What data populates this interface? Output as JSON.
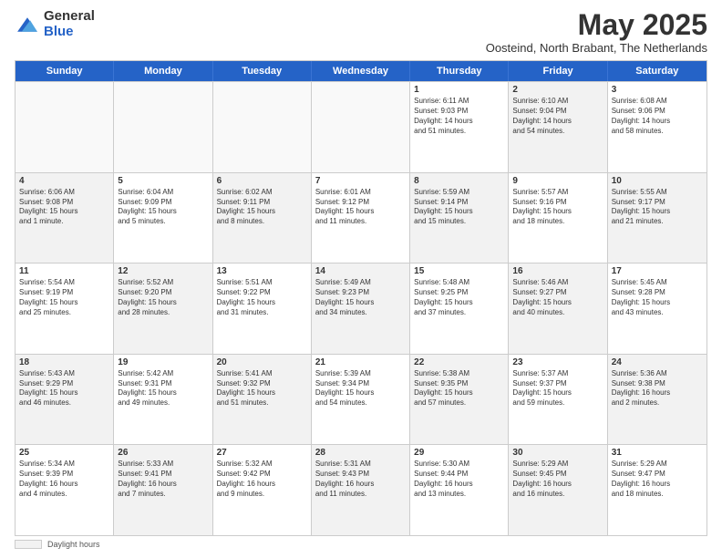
{
  "logo": {
    "general": "General",
    "blue": "Blue"
  },
  "title": "May 2025",
  "subtitle": "Oosteind, North Brabant, The Netherlands",
  "days": [
    "Sunday",
    "Monday",
    "Tuesday",
    "Wednesday",
    "Thursday",
    "Friday",
    "Saturday"
  ],
  "footer_label": "Daylight hours",
  "weeks": [
    [
      {
        "day": "",
        "text": "",
        "empty": true
      },
      {
        "day": "",
        "text": "",
        "empty": true
      },
      {
        "day": "",
        "text": "",
        "empty": true
      },
      {
        "day": "",
        "text": "",
        "empty": true
      },
      {
        "day": "1",
        "text": "Sunrise: 6:11 AM\nSunset: 9:03 PM\nDaylight: 14 hours\nand 51 minutes.",
        "empty": false
      },
      {
        "day": "2",
        "text": "Sunrise: 6:10 AM\nSunset: 9:04 PM\nDaylight: 14 hours\nand 54 minutes.",
        "empty": false,
        "shaded": true
      },
      {
        "day": "3",
        "text": "Sunrise: 6:08 AM\nSunset: 9:06 PM\nDaylight: 14 hours\nand 58 minutes.",
        "empty": false
      }
    ],
    [
      {
        "day": "4",
        "text": "Sunrise: 6:06 AM\nSunset: 9:08 PM\nDaylight: 15 hours\nand 1 minute.",
        "empty": false,
        "shaded": true
      },
      {
        "day": "5",
        "text": "Sunrise: 6:04 AM\nSunset: 9:09 PM\nDaylight: 15 hours\nand 5 minutes.",
        "empty": false
      },
      {
        "day": "6",
        "text": "Sunrise: 6:02 AM\nSunset: 9:11 PM\nDaylight: 15 hours\nand 8 minutes.",
        "empty": false,
        "shaded": true
      },
      {
        "day": "7",
        "text": "Sunrise: 6:01 AM\nSunset: 9:12 PM\nDaylight: 15 hours\nand 11 minutes.",
        "empty": false
      },
      {
        "day": "8",
        "text": "Sunrise: 5:59 AM\nSunset: 9:14 PM\nDaylight: 15 hours\nand 15 minutes.",
        "empty": false,
        "shaded": true
      },
      {
        "day": "9",
        "text": "Sunrise: 5:57 AM\nSunset: 9:16 PM\nDaylight: 15 hours\nand 18 minutes.",
        "empty": false
      },
      {
        "day": "10",
        "text": "Sunrise: 5:55 AM\nSunset: 9:17 PM\nDaylight: 15 hours\nand 21 minutes.",
        "empty": false,
        "shaded": true
      }
    ],
    [
      {
        "day": "11",
        "text": "Sunrise: 5:54 AM\nSunset: 9:19 PM\nDaylight: 15 hours\nand 25 minutes.",
        "empty": false
      },
      {
        "day": "12",
        "text": "Sunrise: 5:52 AM\nSunset: 9:20 PM\nDaylight: 15 hours\nand 28 minutes.",
        "empty": false,
        "shaded": true
      },
      {
        "day": "13",
        "text": "Sunrise: 5:51 AM\nSunset: 9:22 PM\nDaylight: 15 hours\nand 31 minutes.",
        "empty": false
      },
      {
        "day": "14",
        "text": "Sunrise: 5:49 AM\nSunset: 9:23 PM\nDaylight: 15 hours\nand 34 minutes.",
        "empty": false,
        "shaded": true
      },
      {
        "day": "15",
        "text": "Sunrise: 5:48 AM\nSunset: 9:25 PM\nDaylight: 15 hours\nand 37 minutes.",
        "empty": false
      },
      {
        "day": "16",
        "text": "Sunrise: 5:46 AM\nSunset: 9:27 PM\nDaylight: 15 hours\nand 40 minutes.",
        "empty": false,
        "shaded": true
      },
      {
        "day": "17",
        "text": "Sunrise: 5:45 AM\nSunset: 9:28 PM\nDaylight: 15 hours\nand 43 minutes.",
        "empty": false
      }
    ],
    [
      {
        "day": "18",
        "text": "Sunrise: 5:43 AM\nSunset: 9:29 PM\nDaylight: 15 hours\nand 46 minutes.",
        "empty": false,
        "shaded": true
      },
      {
        "day": "19",
        "text": "Sunrise: 5:42 AM\nSunset: 9:31 PM\nDaylight: 15 hours\nand 49 minutes.",
        "empty": false
      },
      {
        "day": "20",
        "text": "Sunrise: 5:41 AM\nSunset: 9:32 PM\nDaylight: 15 hours\nand 51 minutes.",
        "empty": false,
        "shaded": true
      },
      {
        "day": "21",
        "text": "Sunrise: 5:39 AM\nSunset: 9:34 PM\nDaylight: 15 hours\nand 54 minutes.",
        "empty": false
      },
      {
        "day": "22",
        "text": "Sunrise: 5:38 AM\nSunset: 9:35 PM\nDaylight: 15 hours\nand 57 minutes.",
        "empty": false,
        "shaded": true
      },
      {
        "day": "23",
        "text": "Sunrise: 5:37 AM\nSunset: 9:37 PM\nDaylight: 15 hours\nand 59 minutes.",
        "empty": false
      },
      {
        "day": "24",
        "text": "Sunrise: 5:36 AM\nSunset: 9:38 PM\nDaylight: 16 hours\nand 2 minutes.",
        "empty": false,
        "shaded": true
      }
    ],
    [
      {
        "day": "25",
        "text": "Sunrise: 5:34 AM\nSunset: 9:39 PM\nDaylight: 16 hours\nand 4 minutes.",
        "empty": false
      },
      {
        "day": "26",
        "text": "Sunrise: 5:33 AM\nSunset: 9:41 PM\nDaylight: 16 hours\nand 7 minutes.",
        "empty": false,
        "shaded": true
      },
      {
        "day": "27",
        "text": "Sunrise: 5:32 AM\nSunset: 9:42 PM\nDaylight: 16 hours\nand 9 minutes.",
        "empty": false
      },
      {
        "day": "28",
        "text": "Sunrise: 5:31 AM\nSunset: 9:43 PM\nDaylight: 16 hours\nand 11 minutes.",
        "empty": false,
        "shaded": true
      },
      {
        "day": "29",
        "text": "Sunrise: 5:30 AM\nSunset: 9:44 PM\nDaylight: 16 hours\nand 13 minutes.",
        "empty": false
      },
      {
        "day": "30",
        "text": "Sunrise: 5:29 AM\nSunset: 9:45 PM\nDaylight: 16 hours\nand 16 minutes.",
        "empty": false,
        "shaded": true
      },
      {
        "day": "31",
        "text": "Sunrise: 5:29 AM\nSunset: 9:47 PM\nDaylight: 16 hours\nand 18 minutes.",
        "empty": false
      }
    ]
  ]
}
